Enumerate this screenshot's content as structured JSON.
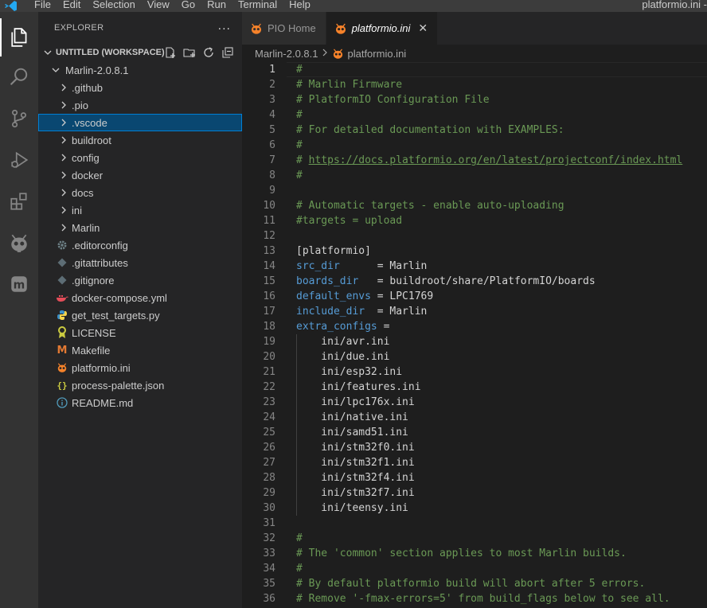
{
  "menu": [
    "File",
    "Edit",
    "Selection",
    "View",
    "Go",
    "Run",
    "Terminal",
    "Help"
  ],
  "window_title": "platformio.ini -",
  "activity_bar": [
    {
      "name": "explorer-icon",
      "active": true
    },
    {
      "name": "search-icon",
      "active": false
    },
    {
      "name": "source-control-icon",
      "active": false
    },
    {
      "name": "run-debug-icon",
      "active": false
    },
    {
      "name": "extensions-icon",
      "active": false
    },
    {
      "name": "platformio-icon",
      "active": false
    },
    {
      "name": "marlin-icon",
      "active": false
    }
  ],
  "sidebar": {
    "title": "EXPLORER",
    "more": "···",
    "workspace": "UNTITLED (WORKSPACE)",
    "root": "Marlin-2.0.8.1",
    "items": [
      {
        "label": ".github",
        "type": "folder"
      },
      {
        "label": ".pio",
        "type": "folder"
      },
      {
        "label": ".vscode",
        "type": "folder",
        "selected": true
      },
      {
        "label": "buildroot",
        "type": "folder"
      },
      {
        "label": "config",
        "type": "folder"
      },
      {
        "label": "docker",
        "type": "folder"
      },
      {
        "label": "docs",
        "type": "folder"
      },
      {
        "label": "ini",
        "type": "folder"
      },
      {
        "label": "Marlin",
        "type": "folder"
      },
      {
        "label": ".editorconfig",
        "type": "file",
        "icon": "gear-icon",
        "color": "#6d8086"
      },
      {
        "label": ".gitattributes",
        "type": "file",
        "icon": "git-icon",
        "color": "#41535b"
      },
      {
        "label": ".gitignore",
        "type": "file",
        "icon": "git-icon",
        "color": "#41535b"
      },
      {
        "label": "docker-compose.yml",
        "type": "file",
        "icon": "docker-icon",
        "color": "#e44d59"
      },
      {
        "label": "get_test_targets.py",
        "type": "file",
        "icon": "python-icon",
        "color": "#3b8fc7"
      },
      {
        "label": "LICENSE",
        "type": "file",
        "icon": "license-icon",
        "color": "#cbcb41"
      },
      {
        "label": "Makefile",
        "type": "file",
        "icon": "makefile-icon",
        "color": "#e37933"
      },
      {
        "label": "platformio.ini",
        "type": "file",
        "icon": "platformio-icon",
        "color": "#f5822a"
      },
      {
        "label": "process-palette.json",
        "type": "file",
        "icon": "json-icon",
        "color": "#cbcb41"
      },
      {
        "label": "README.md",
        "type": "file",
        "icon": "info-icon",
        "color": "#519aba"
      }
    ]
  },
  "tabs": [
    {
      "label": "PIO Home",
      "active": false
    },
    {
      "label": "platformio.ini",
      "active": true,
      "close": "✕"
    }
  ],
  "breadcrumb": [
    "Marlin-2.0.8.1",
    "platformio.ini"
  ],
  "editor": {
    "current_line": 1,
    "lines": [
      {
        "n": "1",
        "parts": [
          {
            "t": "#",
            "c": "comment"
          }
        ]
      },
      {
        "n": "2",
        "parts": [
          {
            "t": "# Marlin Firmware",
            "c": "comment"
          }
        ]
      },
      {
        "n": "3",
        "parts": [
          {
            "t": "# PlatformIO Configuration File",
            "c": "comment"
          }
        ]
      },
      {
        "n": "4",
        "parts": [
          {
            "t": "#",
            "c": "comment"
          }
        ]
      },
      {
        "n": "5",
        "parts": [
          {
            "t": "# For detailed documentation with EXAMPLES:",
            "c": "comment"
          }
        ]
      },
      {
        "n": "6",
        "parts": [
          {
            "t": "#",
            "c": "comment"
          }
        ]
      },
      {
        "n": "7",
        "parts": [
          {
            "t": "# ",
            "c": "comment"
          },
          {
            "t": "https://docs.platformio.org/en/latest/projectconf/index.html",
            "c": "link"
          }
        ]
      },
      {
        "n": "8",
        "parts": [
          {
            "t": "#",
            "c": "comment"
          }
        ]
      },
      {
        "n": "9",
        "parts": []
      },
      {
        "n": "10",
        "parts": [
          {
            "t": "# Automatic targets - enable auto-uploading",
            "c": "comment"
          }
        ]
      },
      {
        "n": "11",
        "parts": [
          {
            "t": "#targets = upload",
            "c": "comment"
          }
        ]
      },
      {
        "n": "12",
        "parts": []
      },
      {
        "n": "13",
        "parts": [
          {
            "t": "[platformio]",
            "c": "section"
          }
        ]
      },
      {
        "n": "14",
        "parts": [
          {
            "t": "src_dir",
            "c": "key"
          },
          {
            "t": "      = Marlin",
            "c": "val"
          }
        ]
      },
      {
        "n": "15",
        "parts": [
          {
            "t": "boards_dir",
            "c": "key"
          },
          {
            "t": "   = buildroot/share/PlatformIO/boards",
            "c": "val"
          }
        ]
      },
      {
        "n": "16",
        "parts": [
          {
            "t": "default_envs",
            "c": "key"
          },
          {
            "t": " = LPC1769",
            "c": "val"
          }
        ]
      },
      {
        "n": "17",
        "parts": [
          {
            "t": "include_dir",
            "c": "key"
          },
          {
            "t": "  = Marlin",
            "c": "val"
          }
        ]
      },
      {
        "n": "18",
        "parts": [
          {
            "t": "extra_configs",
            "c": "key"
          },
          {
            "t": " =",
            "c": "val"
          }
        ]
      },
      {
        "n": "19",
        "indent": true,
        "parts": [
          {
            "t": "    ini/avr.ini",
            "c": "val"
          }
        ]
      },
      {
        "n": "20",
        "indent": true,
        "parts": [
          {
            "t": "    ini/due.ini",
            "c": "val"
          }
        ]
      },
      {
        "n": "21",
        "indent": true,
        "parts": [
          {
            "t": "    ini/esp32.ini",
            "c": "val"
          }
        ]
      },
      {
        "n": "22",
        "indent": true,
        "parts": [
          {
            "t": "    ini/features.ini",
            "c": "val"
          }
        ]
      },
      {
        "n": "23",
        "indent": true,
        "parts": [
          {
            "t": "    ini/lpc176x.ini",
            "c": "val"
          }
        ]
      },
      {
        "n": "24",
        "indent": true,
        "parts": [
          {
            "t": "    ini/native.ini",
            "c": "val"
          }
        ]
      },
      {
        "n": "25",
        "indent": true,
        "parts": [
          {
            "t": "    ini/samd51.ini",
            "c": "val"
          }
        ]
      },
      {
        "n": "26",
        "indent": true,
        "parts": [
          {
            "t": "    ini/stm32f0.ini",
            "c": "val"
          }
        ]
      },
      {
        "n": "27",
        "indent": true,
        "parts": [
          {
            "t": "    ini/stm32f1.ini",
            "c": "val"
          }
        ]
      },
      {
        "n": "28",
        "indent": true,
        "parts": [
          {
            "t": "    ini/stm32f4.ini",
            "c": "val"
          }
        ]
      },
      {
        "n": "29",
        "indent": true,
        "parts": [
          {
            "t": "    ini/stm32f7.ini",
            "c": "val"
          }
        ]
      },
      {
        "n": "30",
        "indent": true,
        "parts": [
          {
            "t": "    ini/teensy.ini",
            "c": "val"
          }
        ]
      },
      {
        "n": "31",
        "parts": []
      },
      {
        "n": "32",
        "parts": [
          {
            "t": "#",
            "c": "comment"
          }
        ]
      },
      {
        "n": "33",
        "parts": [
          {
            "t": "# The 'common' section applies to most Marlin builds.",
            "c": "comment"
          }
        ]
      },
      {
        "n": "34",
        "parts": [
          {
            "t": "#",
            "c": "comment"
          }
        ]
      },
      {
        "n": "35",
        "parts": [
          {
            "t": "# By default platformio build will abort after 5 errors.",
            "c": "comment"
          }
        ]
      },
      {
        "n": "36",
        "parts": [
          {
            "t": "# Remove '-fmax-errors=5' from build_flags below to see all.",
            "c": "comment"
          }
        ]
      }
    ]
  }
}
